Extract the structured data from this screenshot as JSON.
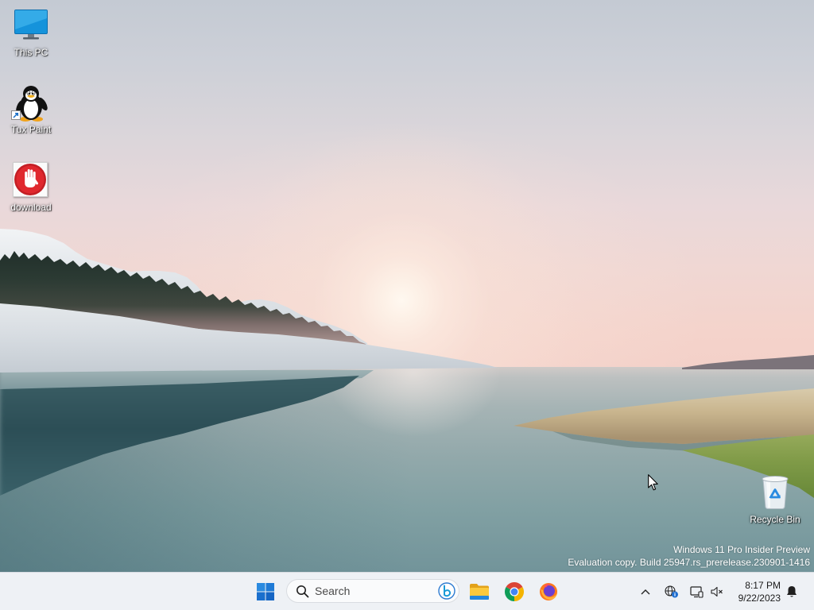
{
  "desktop": {
    "icons": [
      {
        "label": "This PC",
        "icon": "this-pc-icon"
      },
      {
        "label": "Tux Paint",
        "icon": "tux-paint-icon"
      },
      {
        "label": "download",
        "icon": "download-icon"
      },
      {
        "label": "Recycle Bin",
        "icon": "recycle-bin-icon"
      }
    ],
    "watermark": {
      "line1": "Windows 11 Pro Insider Preview",
      "line2": "Evaluation copy. Build 25947.rs_prerelease.230901-1416"
    }
  },
  "taskbar": {
    "start": {
      "icon": "windows-start-icon"
    },
    "search": {
      "placeholder": "Search",
      "icon": "search-icon",
      "badge_icon": "bing-icon"
    },
    "pinned_apps": [
      {
        "icon": "file-explorer-icon"
      },
      {
        "icon": "chrome-icon"
      },
      {
        "icon": "firefox-icon"
      }
    ],
    "tray": {
      "icons": [
        "chevron-up-icon",
        "network-icon",
        "display-icon",
        "speaker-muted-icon"
      ],
      "time": "8:17 PM",
      "date": "9/22/2023",
      "notification_icon": "bell-icon"
    }
  },
  "colors": {
    "taskbar_bg": "#eef1f5",
    "accent": "#1f7ad6",
    "desktop_label": "#ffffff"
  }
}
